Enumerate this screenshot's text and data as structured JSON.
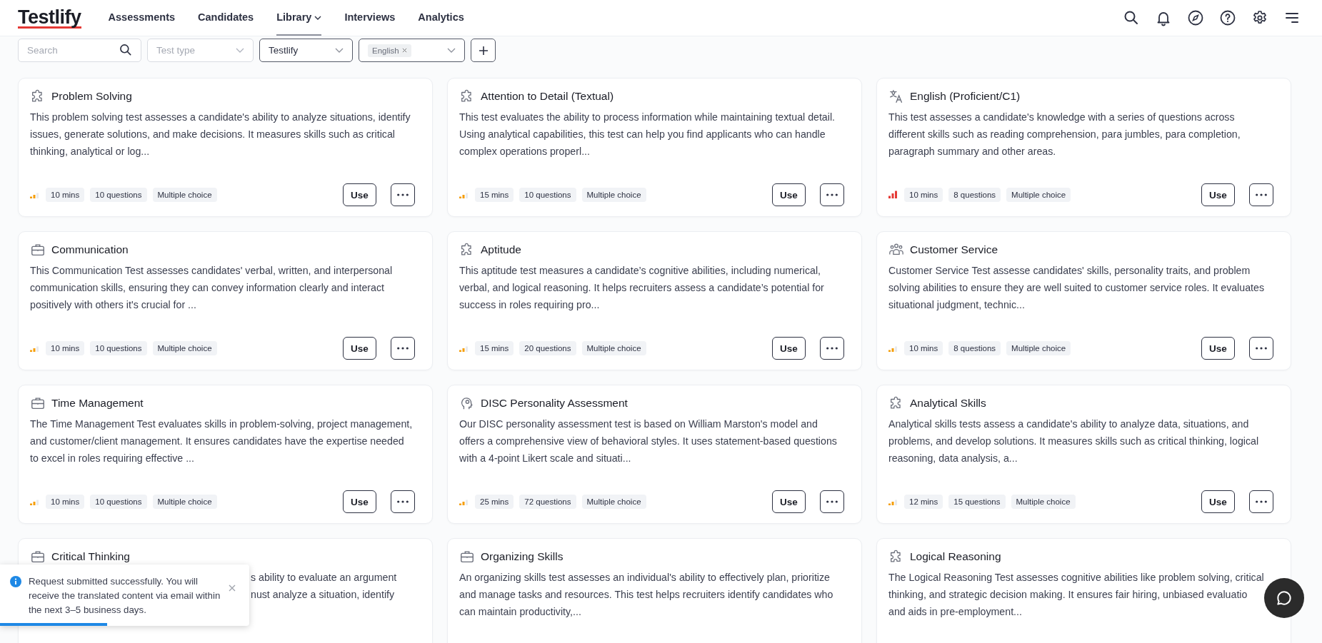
{
  "logo": "Testlify",
  "nav": [
    {
      "label": "Assessments",
      "selected": false,
      "dropdown": false
    },
    {
      "label": "Candidates",
      "selected": false,
      "dropdown": false
    },
    {
      "label": "Library",
      "selected": true,
      "dropdown": true
    },
    {
      "label": "Interviews",
      "selected": false,
      "dropdown": false
    },
    {
      "label": "Analytics",
      "selected": false,
      "dropdown": false
    }
  ],
  "filters": {
    "search": {
      "placeholder": "Search"
    },
    "test_type": {
      "placeholder": "Test type"
    },
    "provider": {
      "value": "Testlify"
    },
    "language": {
      "chips": [
        "English"
      ]
    }
  },
  "cards": [
    {
      "kind": "puzzle",
      "title": "Problem Solving",
      "description": "This problem solving test assesses a candidate's ability to analyze situations, identify issues, generate solutions, and make decisions. It measures skills such as critical thinking, analytical or log...",
      "level": 0.67,
      "tags": [
        "10 mins",
        "10 questions",
        "Multiple choice"
      ],
      "button": "Use"
    },
    {
      "kind": "puzzle",
      "title": "Attention to Detail (Textual)",
      "description": "This test evaluates the ability to process information while maintaining textual detail. Using analytical capabilities, this test can help you find applicants who can handle complex operations properl...",
      "level": 0.67,
      "tags": [
        "15 mins",
        "10 questions",
        "Multiple choice"
      ],
      "button": "Use"
    },
    {
      "kind": "translate",
      "title": "English (Proficient/C1)",
      "description": "This test assesses a candidate's knowledge with a series of questions across different skills such as reading comprehension, para jumbles, para completion, paragraph summary and other areas.",
      "level": 1,
      "tags": [
        "10 mins",
        "8 questions",
        "Multiple choice"
      ],
      "button": "Use"
    },
    {
      "kind": "briefcase",
      "title": "Communication",
      "description": "This Communication Test assesses candidates' verbal, written, and interpersonal communication skills, ensuring they can convey information clearly and interact positively with others it's crucial for ...",
      "level": 0.67,
      "tags": [
        "10 mins",
        "10 questions",
        "Multiple choice"
      ],
      "button": "Use"
    },
    {
      "kind": "puzzle",
      "title": "Aptitude",
      "description": "This aptitude test measures a candidate’s cognitive abilities, including numerical, verbal, and logical reasoning. It helps recruiters assess a candidate’s potential for success in roles requiring pro...",
      "level": 0.67,
      "tags": [
        "15 mins",
        "20 questions",
        "Multiple choice"
      ],
      "button": "Use"
    },
    {
      "kind": "people",
      "title": "Customer Service",
      "description": "Customer Service Test assesse candidates' skills, personality traits, and problem solving abilities to ensure they are well suited to customer service roles. It evaluates situational judgment, technic...",
      "level": 0.67,
      "tags": [
        "10 mins",
        "8 questions",
        "Multiple choice"
      ],
      "button": "Use"
    },
    {
      "kind": "briefcase",
      "title": "Time Management",
      "description": "The Time Management Test evaluates skills in problem-solving, project management, and customer/client management. It ensures candidates have the expertise needed to excel in roles requiring effective ...",
      "level": 0.67,
      "tags": [
        "10 mins",
        "10 questions",
        "Multiple choice"
      ],
      "button": "Use"
    },
    {
      "kind": "head",
      "title": "DISC Personality Assessment",
      "description": "Our DISC personality assessment test is based on William Marston's model and offers a comprehensive view of behavioral styles. It uses statement-based questions with a 4-point Likert scale and situati...",
      "level": 0.67,
      "tags": [
        "25 mins",
        "72 questions",
        "Multiple choice"
      ],
      "button": "Use"
    },
    {
      "kind": "puzzle",
      "title": "Analytical Skills",
      "description": "Analytical skills tests assess a candidate's ability to analyze data, situations, and problems, and develop solutions. It measures skills such as critical thinking, logical reasoning, data analysis, a...",
      "level": 0.67,
      "tags": [
        "12 mins",
        "15 questions",
        "Multiple choice"
      ],
      "button": "Use"
    },
    {
      "kind": "briefcase",
      "title": "Critical Thinking",
      "description_fragments": [
        "s ability to evaluate an argument",
        "nust analyze a situation, identify"
      ]
    },
    {
      "kind": "briefcase",
      "title": "Organizing Skills",
      "description": "An organizing skills test assesses an individual's ability to effectively plan, prioritize and manage tasks and resources. This test helps recruiters identify candidates who can maintain productivity,..."
    },
    {
      "kind": "puzzle",
      "title": "Logical Reasoning",
      "description_lines": [
        "The Logical Reasoning Test assesses cognitive abilities like problem solving, critical",
        "thinking, and strategic decision making. It ensures fair hiring, unbiased evaluatio",
        "and aids in pre-employment..."
      ]
    }
  ],
  "toast": {
    "message": "Request submitted successfully. You will receive the translated content via email within the next 3–5 business days.",
    "level": 0.43
  }
}
